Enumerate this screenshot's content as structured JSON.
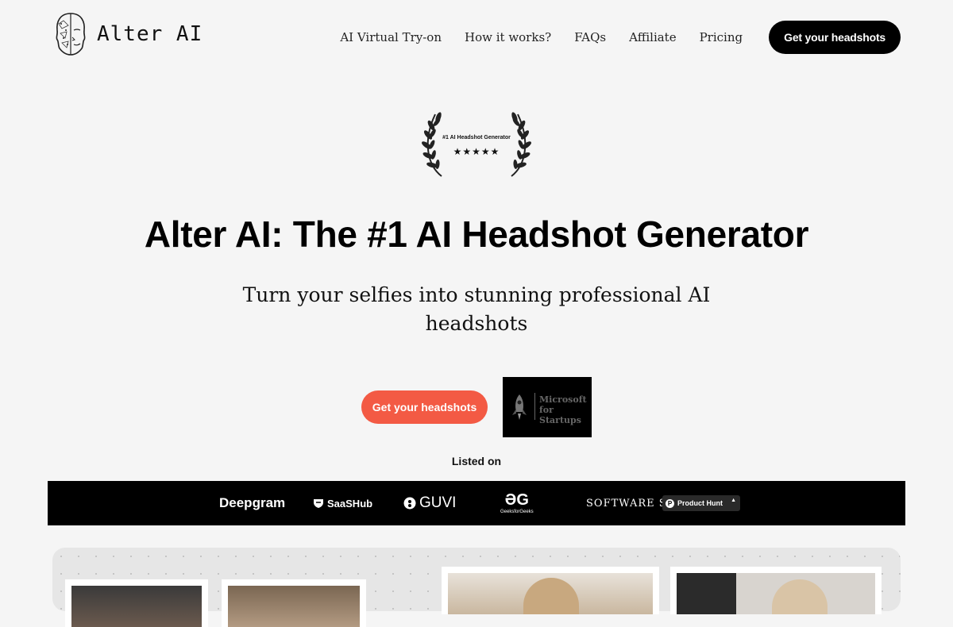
{
  "brand": {
    "name": "Alter AI"
  },
  "nav": {
    "links": [
      "AI Virtual Try-on",
      "How it works?",
      "FAQs",
      "Affiliate",
      "Pricing"
    ],
    "cta_label": "Get your headshots"
  },
  "badge": {
    "label": "#1 AI Headshot Generator",
    "stars": "★★★★★",
    "rating": 5
  },
  "hero": {
    "title": "Alter AI: The #1 AI Headshot Generator",
    "subtitle": "Turn your selfies into stunning professional AI headshots",
    "cta_label": "Get your headshots",
    "listed_on": "Listed on"
  },
  "featured_badge": {
    "text": "Microsoft for Startups"
  },
  "listed_logos": {
    "deepgram": "Deepgram",
    "saashub": "SaaSHub",
    "guvi": "GUVI",
    "gfg_mark": "ƏG",
    "gfg_name": "GeeksforGeeks",
    "software_suggest": "SOFTWARE SUGGEST",
    "producthunt": "Product Hunt"
  },
  "colors": {
    "accent": "#f35a44",
    "dark": "#000000",
    "background": "#f5f5f5"
  },
  "icons": [
    "logo-face-icon",
    "laurel-left-icon",
    "laurel-right-icon",
    "rocket-icon",
    "shield-icon",
    "guvi-icon",
    "producthunt-icon"
  ]
}
